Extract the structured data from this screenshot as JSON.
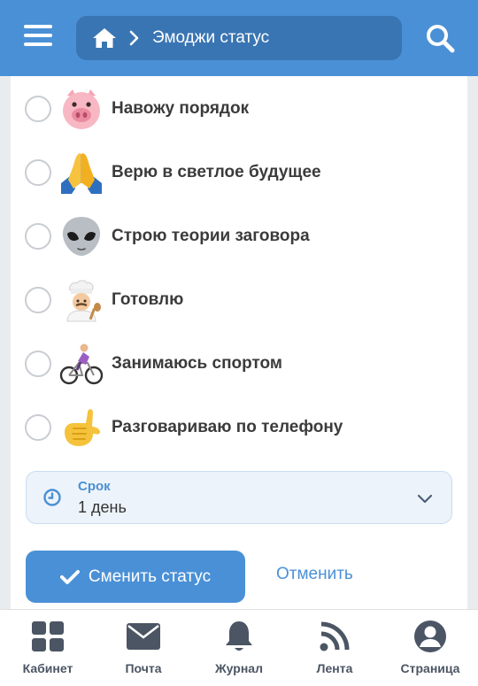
{
  "header": {
    "menu_icon": "hamburger-icon",
    "home_icon": "home-icon",
    "breadcrumb_separator_icon": "chevron-right-icon",
    "breadcrumb_title": "Эмоджи статус",
    "search_icon": "search-icon",
    "accent_color": "#4a90d6"
  },
  "status_options": [
    {
      "emoji": "pig-face",
      "label": "Навожу порядок"
    },
    {
      "emoji": "folded-hands",
      "label": "Верю в светлое будущее"
    },
    {
      "emoji": "alien",
      "label": "Строю теории заговора"
    },
    {
      "emoji": "cook",
      "label": "Готовлю"
    },
    {
      "emoji": "person-biking",
      "label": "Занимаюсь спортом"
    },
    {
      "emoji": "call-me-hand",
      "label": "Разговариваю по телефону"
    }
  ],
  "term": {
    "icon": "clock-icon",
    "label": "Срок",
    "value": "1 день",
    "dropdown_icon": "chevron-down-icon"
  },
  "actions": {
    "submit_icon": "check-icon",
    "submit_label": "Сменить статус",
    "cancel_label": "Отменить"
  },
  "bottom_nav": [
    {
      "icon": "grid-icon",
      "label": "Кабинет"
    },
    {
      "icon": "mail-icon",
      "label": "Почта"
    },
    {
      "icon": "bell-icon",
      "label": "Журнал"
    },
    {
      "icon": "rss-icon",
      "label": "Лента"
    },
    {
      "icon": "user-icon",
      "label": "Страница"
    }
  ]
}
